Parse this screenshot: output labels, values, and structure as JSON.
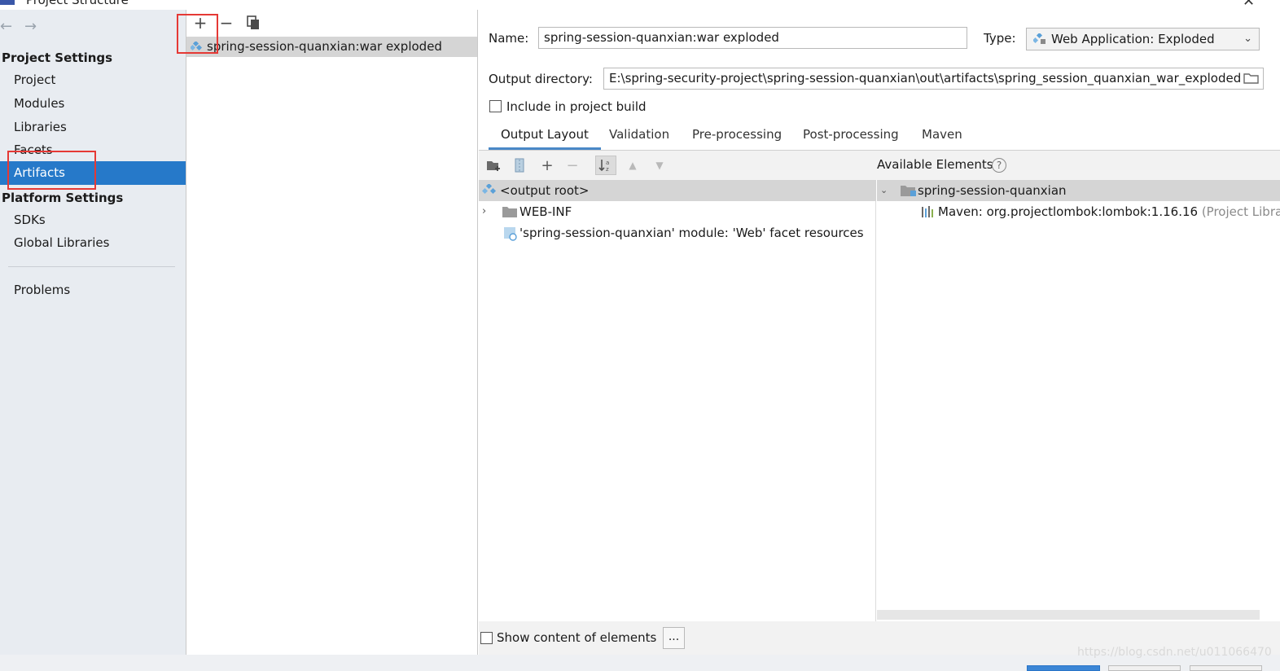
{
  "window": {
    "title": "Project Structure",
    "close_glyph": "✕"
  },
  "nav": {
    "back": "←",
    "forward": "→"
  },
  "sidebar": {
    "project_settings_label": "Project Settings",
    "project_items": [
      {
        "label": "Project"
      },
      {
        "label": "Modules"
      },
      {
        "label": "Libraries"
      },
      {
        "label": "Facets"
      },
      {
        "label": "Artifacts",
        "selected": true
      }
    ],
    "platform_settings_label": "Platform Settings",
    "platform_items": [
      {
        "label": "SDKs"
      },
      {
        "label": "Global Libraries"
      }
    ],
    "problems_label": "Problems"
  },
  "artifact_toolbar": {
    "add": "+",
    "remove": "−"
  },
  "artifacts": [
    {
      "label": "spring-session-quanxian:war exploded",
      "icon": "artifact-web-icon",
      "selected": true
    }
  ],
  "config": {
    "name_label": "Name:",
    "name_value": "spring-session-quanxian:war exploded",
    "type_label": "Type:",
    "type_value": "Web Application: Exploded",
    "output_dir_label": "Output directory:",
    "output_dir_value": "E:\\spring-security-project\\spring-session-quanxian\\out\\artifacts\\spring_session_quanxian_war_exploded",
    "include_build_label": "Include in project build",
    "include_build_checked": false
  },
  "tabs": [
    {
      "label": "Output Layout",
      "active": true
    },
    {
      "label": "Validation"
    },
    {
      "label": "Pre-processing"
    },
    {
      "label": "Post-processing"
    },
    {
      "label": "Maven"
    }
  ],
  "layout_toolbar": {
    "add": "+",
    "remove": "−",
    "up": "▲",
    "down": "▼"
  },
  "available_elements_label": "Available Elements",
  "help_glyph": "?",
  "output_tree": [
    {
      "label": "<output root>",
      "icon": "output-root-icon",
      "selected": true
    },
    {
      "label": "WEB-INF",
      "icon": "folder-icon",
      "expandable": true
    },
    {
      "label": "'spring-session-quanxian' module: 'Web' facet resources",
      "icon": "web-facet-icon"
    }
  ],
  "available_tree": [
    {
      "label": "spring-session-quanxian",
      "icon": "module-folder-icon",
      "expanded": true,
      "selected": true
    },
    {
      "label": "Maven: org.projectlombok:lombok:1.16.16",
      "suffix": "(Project Libra",
      "icon": "library-icon"
    }
  ],
  "bottom": {
    "show_content_label": "Show content of elements",
    "show_content_checked": false,
    "dots_label": "..."
  },
  "watermark": "https://blog.csdn.net/u011066470",
  "colors": {
    "selection": "#2679c9",
    "annotation": "#e53935",
    "sidebar_bg": "#e8ecf1"
  }
}
